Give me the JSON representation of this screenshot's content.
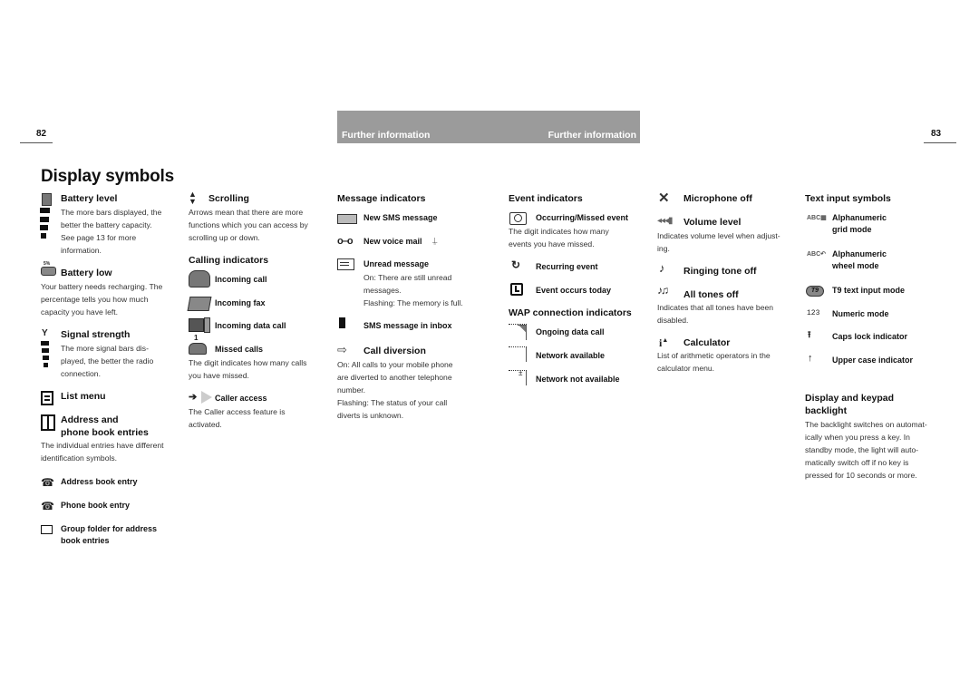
{
  "page_left_number": "82",
  "page_right_number": "83",
  "header_band": {
    "left_label": "Further information",
    "right_label": "Further information",
    "color": "#9b9b9b"
  },
  "title": "Display symbols",
  "col1": {
    "battery_level": {
      "heading": "Battery level",
      "text": [
        "The more bars displayed, the",
        "better the battery capacity.",
        "See page 13 for more",
        "information."
      ]
    },
    "battery_low": {
      "heading": "Battery low",
      "icon_label": "5%",
      "text": [
        "Your battery needs recharging. The",
        "percentage tells you how much",
        "capacity you have left."
      ]
    },
    "signal": {
      "heading": "Signal strength",
      "text": [
        "The more signal bars dis-",
        "played, the better the radio",
        "connection."
      ]
    },
    "list_menu": {
      "heading": "List menu"
    },
    "address": {
      "heading_line1": "Address and",
      "heading_line2": "phone book entries",
      "text": [
        "The individual entries have different",
        "identification symbols."
      ]
    },
    "address_entry": "Address book entry",
    "phone_entry": "Phone book entry",
    "group_folder": [
      "Group folder for address",
      "book entries"
    ]
  },
  "col2": {
    "scrolling": {
      "heading": "Scrolling",
      "text": [
        "Arrows mean that there are more",
        "functions which you can access by",
        "scrolling up or down."
      ]
    },
    "calling_heading": "Calling indicators",
    "incoming_call": "Incoming call",
    "incoming_fax": "Incoming fax",
    "incoming_data": "Incoming data call",
    "missed_calls": {
      "label": "Missed calls",
      "digit": "1",
      "text": [
        "The digit indicates how many calls",
        "you have missed."
      ]
    },
    "caller_access": {
      "label": "Caller access",
      "text": [
        "The Caller access feature is",
        "activated."
      ]
    }
  },
  "col3": {
    "heading": "Message indicators",
    "new_sms": "New SMS message",
    "new_voice": "New voice mail",
    "unread": {
      "label": "Unread message",
      "text": [
        "On: There are still unread",
        "messages.",
        "Flashing: The memory is full."
      ]
    },
    "sms_inbox": "SMS message in inbox",
    "call_diversion": {
      "heading": "Call diversion",
      "text": [
        "On: All calls to your mobile phone",
        "are diverted to another telephone",
        "number.",
        "Flashing: The status of your call",
        "diverts is unknown."
      ]
    }
  },
  "col4": {
    "heading": "Event indicators",
    "occurring": {
      "label": "Occurring/Missed event",
      "text": [
        "The digit indicates how many",
        "events you have missed."
      ]
    },
    "recurring": "Recurring event",
    "today": "Event occurs today",
    "wap_heading": "WAP connection indicators",
    "ongoing": "Ongoing data call",
    "net_avail": "Network available",
    "net_not": "Network not available"
  },
  "col5": {
    "mic_off": "Microphone off",
    "volume": {
      "heading": "Volume level",
      "text": [
        "Indicates volume level when adjust-",
        "ing."
      ]
    },
    "ring_off": "Ringing tone off",
    "all_off": {
      "heading": "All tones off",
      "text": [
        "Indicates that all tones have been",
        "disabled."
      ]
    },
    "calculator": {
      "heading": "Calculator",
      "text": [
        "List of arithmetic operators in the",
        "calculator menu."
      ]
    }
  },
  "col6": {
    "heading": "Text input symbols",
    "grid": [
      "Alphanumeric",
      "grid mode"
    ],
    "wheel": [
      "Alphanumeric",
      "wheel mode"
    ],
    "t9": "T9 text input mode",
    "t9_icon": "T9",
    "numeric": "Numeric mode",
    "numeric_icon": "123",
    "caps": "Caps lock indicator",
    "upper": "Upper case indicator",
    "backlight": {
      "heading_line1": "Display and keypad",
      "heading_line2": "backlight",
      "text": [
        "The backlight switches on automat-",
        "ically when you press a key. In",
        "standby mode, the light will auto-",
        "matically switch off if no key is",
        "pressed for 10 seconds or more."
      ]
    }
  }
}
